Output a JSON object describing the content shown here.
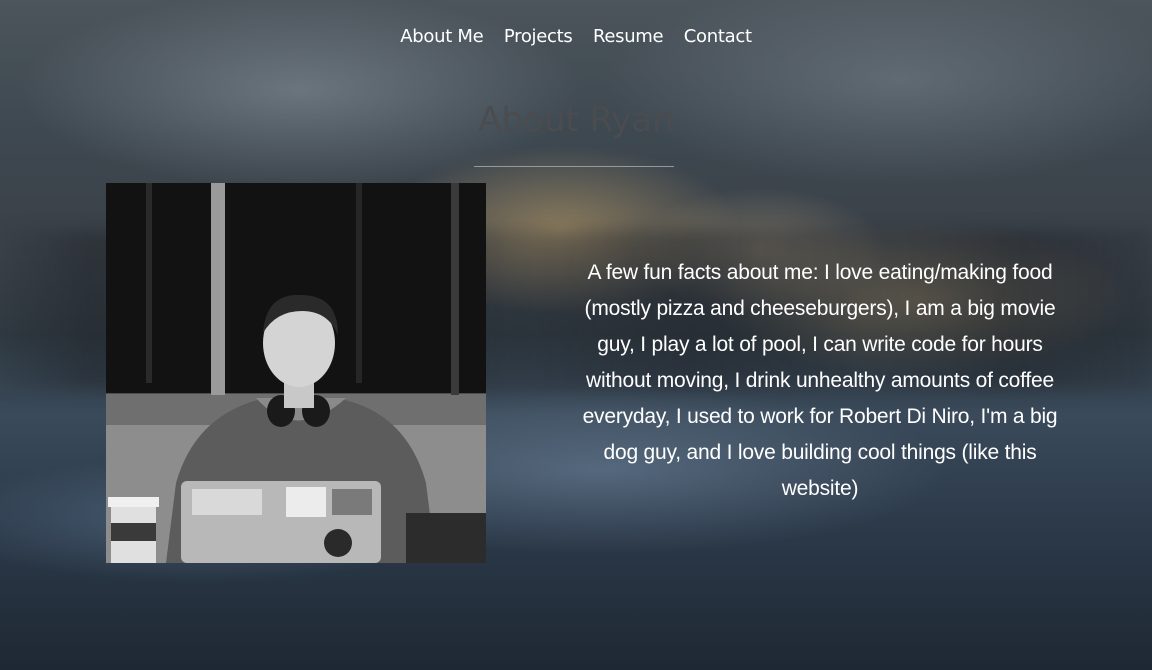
{
  "nav": {
    "items": [
      {
        "label": "About Me"
      },
      {
        "label": "Projects"
      },
      {
        "label": "Resume"
      },
      {
        "label": "Contact"
      }
    ]
  },
  "about": {
    "title": "About Ryan",
    "bio": "A few fun facts about me: I love eating/making food (mostly pizza and cheeseburgers), I am a big movie guy, I play a lot of pool, I can write code for hours without moving, I drink unhealthy amounts of coffee everyday, I used to work for Robert Di Niro, I'm a big dog guy, and I love building cool things (like this website)"
  },
  "photo": {
    "description": "profile-photo",
    "style": "black-and-white"
  },
  "colors": {
    "nav_text": "#ffffff",
    "title_text": "#4a4c50",
    "bio_text": "#ffffff",
    "divider": "#aab4be"
  }
}
